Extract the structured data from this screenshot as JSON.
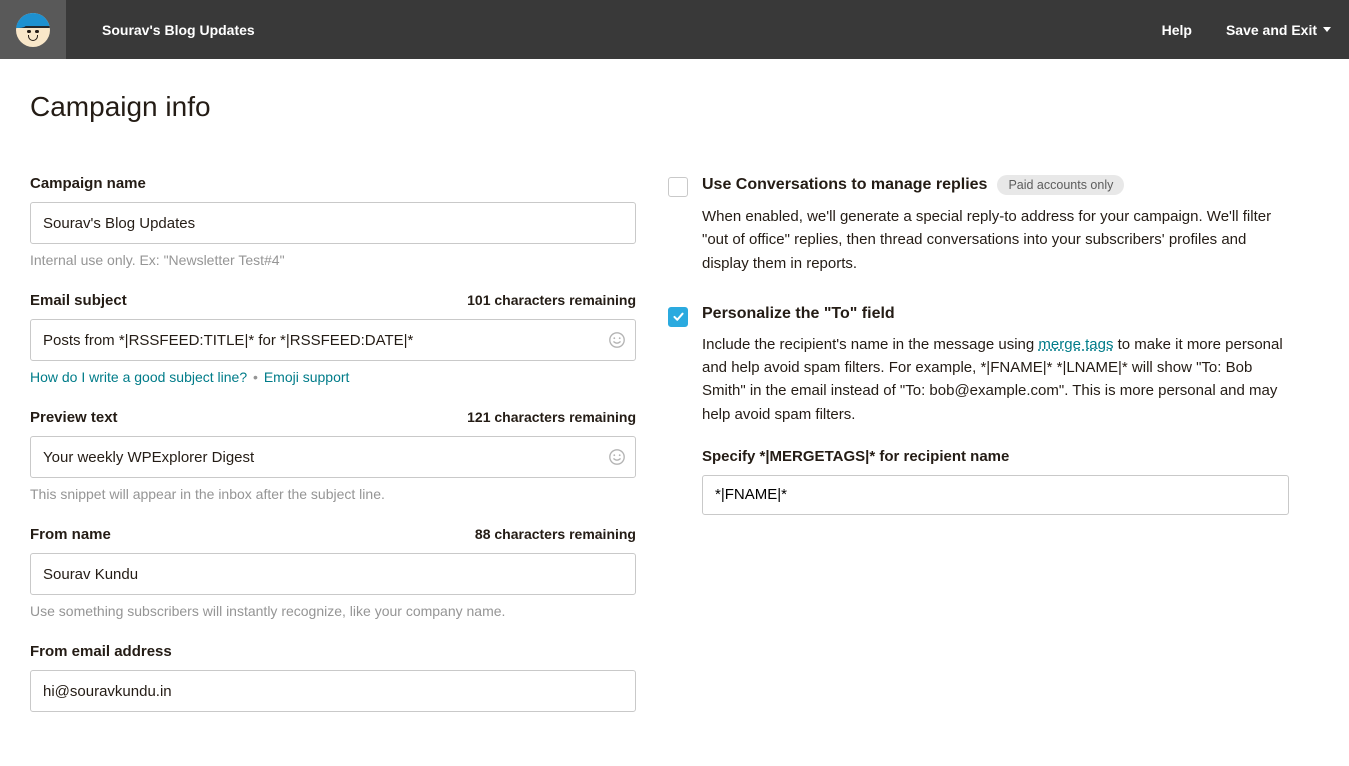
{
  "header": {
    "title": "Sourav's Blog Updates",
    "help": "Help",
    "save_exit": "Save and Exit"
  },
  "page_title": "Campaign info",
  "left": {
    "campaign_name": {
      "label": "Campaign name",
      "value": "Sourav's Blog Updates",
      "help": "Internal use only. Ex: \"Newsletter Test#4\""
    },
    "email_subject": {
      "label": "Email subject",
      "chars": "101 characters remaining",
      "value": "Posts from *|RSSFEED:TITLE|* for *|RSSFEED:DATE|*",
      "link1": "How do I write a good subject line?",
      "sep": "•",
      "link2": "Emoji support"
    },
    "preview_text": {
      "label": "Preview text",
      "chars": "121 characters remaining",
      "value": "Your weekly WPExplorer Digest",
      "help": "This snippet will appear in the inbox after the subject line."
    },
    "from_name": {
      "label": "From name",
      "chars": "88 characters remaining",
      "value": "Sourav Kundu",
      "help": "Use something subscribers will instantly recognize, like your company name."
    },
    "from_email": {
      "label": "From email address",
      "value": "hi@souravkundu.in"
    }
  },
  "right": {
    "conversations": {
      "title": "Use Conversations to manage replies",
      "badge": "Paid accounts only",
      "desc": "When enabled, we'll generate a special reply-to address for your campaign. We'll filter \"out of office\" replies, then thread conversations into your subscribers' profiles and display them in reports."
    },
    "personalize": {
      "title": "Personalize the \"To\" field",
      "desc_pre": "Include the recipient's name in the message using ",
      "link": "merge tags",
      "desc_post": " to make it more personal and help avoid spam filters. For example, *|FNAME|* *|LNAME|* will show \"To: Bob Smith\" in the email instead of \"To: bob@example.com\". This is more personal and may help avoid spam filters.",
      "merge_label": "Specify *|MERGETAGS|* for recipient name",
      "merge_value": "*|FNAME|*"
    }
  }
}
